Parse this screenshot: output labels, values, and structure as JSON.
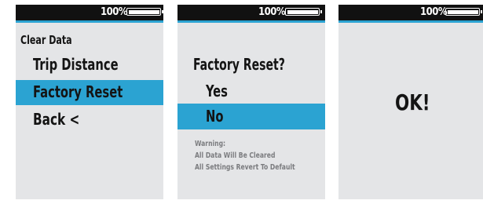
{
  "battery_label": "100%",
  "battery_level": 1.0,
  "accent_color": "#2ba3d2",
  "screens": [
    {
      "heading": "Clear Data",
      "items": [
        "Trip Distance",
        "Factory Reset",
        "Back <"
      ],
      "selected": "Factory Reset"
    },
    {
      "question": "Factory Reset?",
      "options": [
        "Yes",
        "No"
      ],
      "selected": "No",
      "warning_title": "Warning:",
      "warning_lines": [
        "All Data Will Be Cleared",
        "All Settings Revert To Default"
      ]
    },
    {
      "message": "OK!"
    }
  ]
}
